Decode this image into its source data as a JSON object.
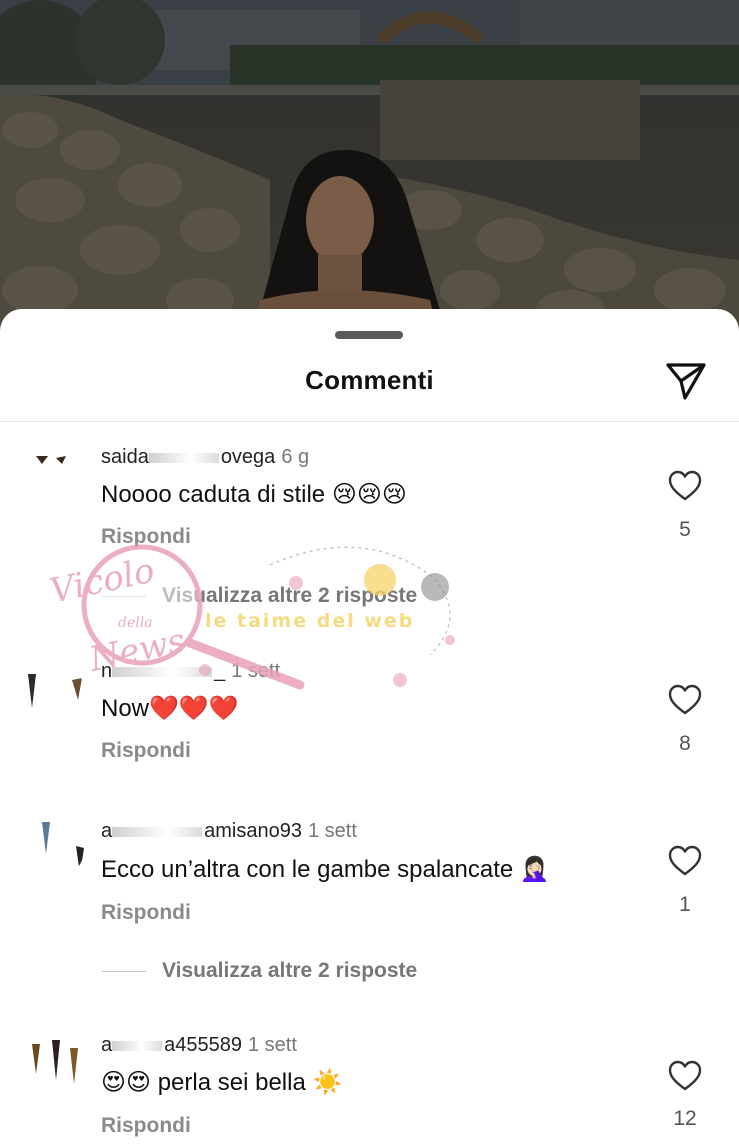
{
  "sheet": {
    "title": "Commenti"
  },
  "comments": [
    {
      "username": "saida",
      "username_end": "ovega",
      "time": "6 g",
      "text": "Noooo caduta di stile 😢😢😢",
      "reply_label": "Rispondi",
      "likes": "5",
      "view_replies": "Visualizza altre 2 risposte"
    },
    {
      "username": "n",
      "username_end": "_",
      "time": "1 sett",
      "text": "Now❤️❤️❤️",
      "reply_label": "Rispondi",
      "likes": "8"
    },
    {
      "username": "a",
      "username_end": "amisano93",
      "time": "1 sett",
      "text": "Ecco un’altra con le gambe spalancate 🤦🏻‍♀️",
      "reply_label": "Rispondi",
      "likes": "1",
      "view_replies": "Visualizza altre 2 risposte"
    },
    {
      "username": "a",
      "username_end": "a455589",
      "time": "1 sett",
      "text": "😍😍 perla sei bella ☀️",
      "reply_label": "Rispondi",
      "likes": "12"
    }
  ],
  "watermark": {
    "logo_line1": "Vicolo",
    "logo_line2": "della",
    "logo_line3": "News",
    "tagline": "le taime del web"
  },
  "colors": {
    "sheet_bg": "#ffffff",
    "text_primary": "#111111",
    "text_secondary": "#8a8a8a",
    "handle": "#5b5b5b",
    "watermark_pink": "#e8a0b8",
    "watermark_yellow": "#f5d56a"
  },
  "icons": {
    "share": "paper-plane-icon",
    "like": "heart-outline-icon",
    "handle": "grab-handle"
  }
}
